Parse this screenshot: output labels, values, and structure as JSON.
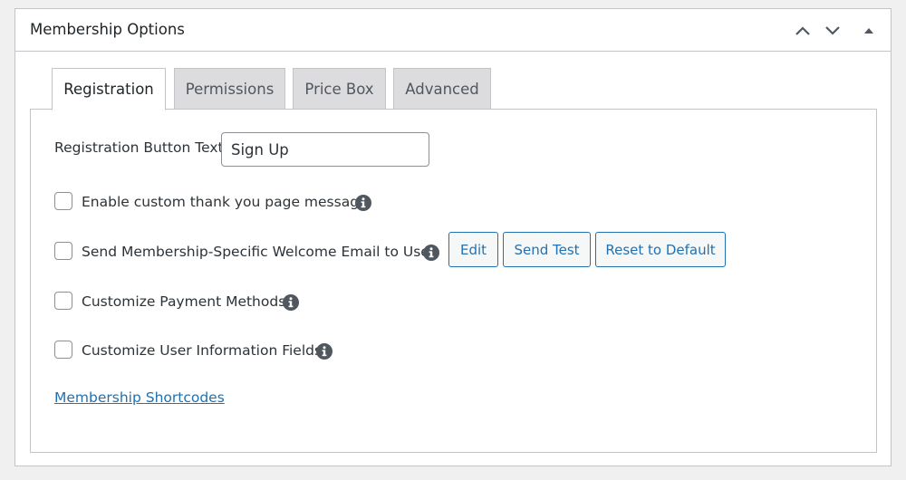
{
  "metabox": {
    "title": "Membership Options",
    "controls": {
      "move_up_icon": "chevron-up-icon",
      "move_down_icon": "chevron-down-icon",
      "toggle_icon": "triangle-up-icon"
    }
  },
  "tabs": [
    {
      "label": "Registration",
      "active": true
    },
    {
      "label": "Permissions",
      "active": false
    },
    {
      "label": "Price Box",
      "active": false
    },
    {
      "label": "Advanced",
      "active": false
    }
  ],
  "registration": {
    "button_text_label": "Registration Button Text:",
    "button_text_value": "Sign Up",
    "options": [
      {
        "label": "Enable custom thank you page message",
        "checked": false
      },
      {
        "label": "Send Membership-Specific Welcome Email to User",
        "checked": false
      },
      {
        "label": "Customize Payment Methods",
        "checked": false
      },
      {
        "label": "Customize User Information Fields",
        "checked": false
      }
    ],
    "email_buttons": {
      "edit": "Edit",
      "send_test": "Send Test",
      "reset": "Reset to Default"
    },
    "shortcodes_link": "Membership Shortcodes"
  },
  "colors": {
    "accent": "#2271b1",
    "border": "#c3c4c7",
    "tab_inactive_bg": "#dcdcde",
    "background": "#f0f0f1"
  }
}
